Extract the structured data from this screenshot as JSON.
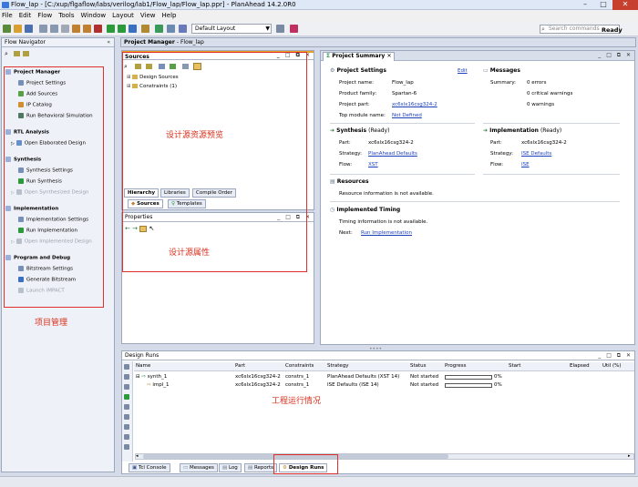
{
  "window": {
    "title": "Flow_lap - [C:/xup/flgaflow/labs/verilog/lab1/Flow_lap/Flow_lap.ppr] - PlanAhead 14.2.0R0",
    "min": "–",
    "max": "□",
    "close": "✕"
  },
  "menu": [
    "File",
    "Edit",
    "Flow",
    "Tools",
    "Window",
    "Layout",
    "View",
    "Help"
  ],
  "toolbar": {
    "layout_value": "Default Layout",
    "search_placeholder": "Search commands",
    "status": "Ready"
  },
  "flow_navigator": {
    "title": "Flow Navigator",
    "collapse": "«",
    "sections": [
      {
        "title": "Project Manager",
        "items": [
          {
            "label": "Project Settings",
            "enabled": true
          },
          {
            "label": "Add Sources",
            "enabled": true
          },
          {
            "label": "IP Catalog",
            "enabled": true
          },
          {
            "label": "Run Behavioral Simulation",
            "enabled": true
          }
        ]
      },
      {
        "title": "RTL Analysis",
        "items": [
          {
            "label": "Open Elaborated Design",
            "enabled": true
          }
        ]
      },
      {
        "title": "Synthesis",
        "items": [
          {
            "label": "Synthesis Settings",
            "enabled": true
          },
          {
            "label": "Run Synthesis",
            "enabled": true
          },
          {
            "label": "Open Synthesized Design",
            "enabled": false
          }
        ]
      },
      {
        "title": "Implementation",
        "items": [
          {
            "label": "Implementation Settings",
            "enabled": true
          },
          {
            "label": "Run Implementation",
            "enabled": true
          },
          {
            "label": "Open Implemented Design",
            "enabled": false
          }
        ]
      },
      {
        "title": "Program and Debug",
        "items": [
          {
            "label": "Bitstream Settings",
            "enabled": true
          },
          {
            "label": "Generate Bitstream",
            "enabled": true
          },
          {
            "label": "Launch iMPACT",
            "enabled": false
          }
        ]
      }
    ]
  },
  "project_manager_hdr": {
    "title": "Project Manager",
    "subtitle": "- Flow_lap"
  },
  "sources": {
    "title": "Sources",
    "tree": [
      "Design Sources",
      "Constraints (1)"
    ],
    "tabs": [
      "Hierarchy",
      "Libraries",
      "Compile Order"
    ],
    "bottom_tabs": [
      "Sources",
      "Templates"
    ]
  },
  "properties": {
    "title": "Properties"
  },
  "summary": {
    "tab": "Project Summary",
    "settings": {
      "title": "Project Settings",
      "edit": "Edit",
      "rows": [
        [
          "Project name:",
          "Flow_lap"
        ],
        [
          "Product family:",
          "Spartan-6"
        ],
        [
          "Project part:",
          "xc6slx16csg324-2"
        ],
        [
          "Top module name:",
          "Not Defined"
        ]
      ]
    },
    "messages": {
      "title": "Messages",
      "summary_label": "Summary:",
      "rows": [
        "0 errors",
        "0 critical warnings",
        "0 warnings"
      ]
    },
    "synthesis": {
      "title": "Synthesis",
      "state": "(Ready)",
      "rows": [
        [
          "Part:",
          "xc6slx16csg324-2"
        ],
        [
          "Strategy:",
          "PlanAhead Defaults"
        ],
        [
          "Flow:",
          "XST"
        ]
      ]
    },
    "implementation": {
      "title": "Implementation",
      "state": "(Ready)",
      "rows": [
        [
          "Part:",
          "xc6slx16csg324-2"
        ],
        [
          "Strategy:",
          "ISE Defaults"
        ],
        [
          "Flow:",
          "ISE"
        ]
      ]
    },
    "resources": {
      "title": "Resources",
      "text": "Resource information is not available."
    },
    "timing": {
      "title": "Implemented Timing",
      "text": "Timing information is not available.",
      "next_label": "Next:",
      "next_link": "Run Implementation"
    }
  },
  "design_runs": {
    "title": "Design Runs",
    "columns": [
      "Name",
      "Part",
      "Constraints",
      "Strategy",
      "Status",
      "Progress",
      "Start",
      "Elapsed",
      "Util (%)"
    ],
    "rows": [
      {
        "name": "synth_1",
        "part": "xc6slx16csg324-2",
        "constraints": "constrs_1",
        "strategy": "PlanAhead Defaults (XST 14)",
        "status": "Not started",
        "progress": 0,
        "progress_text": "0%"
      },
      {
        "name": "impl_1",
        "part": "xc6slx16csg324-2",
        "constraints": "constrs_1",
        "strategy": "ISE Defaults (ISE 14)",
        "status": "Not started",
        "progress": 0,
        "progress_text": "0%"
      }
    ]
  },
  "bottom_tabs": [
    "Tcl Console",
    "Messages",
    "Log",
    "Reports",
    "Design Runs"
  ],
  "annotations": {
    "sources_preview": "设计源资源预览",
    "source_props": "设计源属性",
    "project_mgmt": "项目管理",
    "run_status": "工程运行情况"
  }
}
